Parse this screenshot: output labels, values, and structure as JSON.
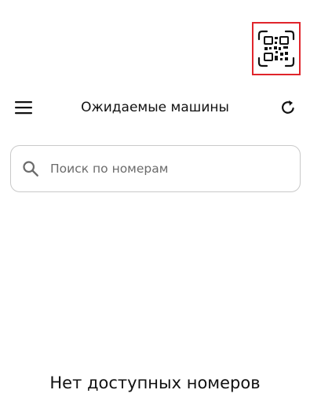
{
  "header": {
    "title": "Ожидаемые машины",
    "menu_icon": "hamburger-menu-icon",
    "refresh_icon": "refresh-icon",
    "qr_icon": "qr-code-scan-icon"
  },
  "search": {
    "placeholder": "Поиск по номерам",
    "value": "",
    "icon": "search-icon"
  },
  "empty_state": {
    "message": "Нет доступных номеров"
  },
  "colors": {
    "qr_highlight_border": "#e0242b",
    "text": "#111111",
    "search_border": "#c9c9c9",
    "placeholder": "#6b6b6b"
  }
}
